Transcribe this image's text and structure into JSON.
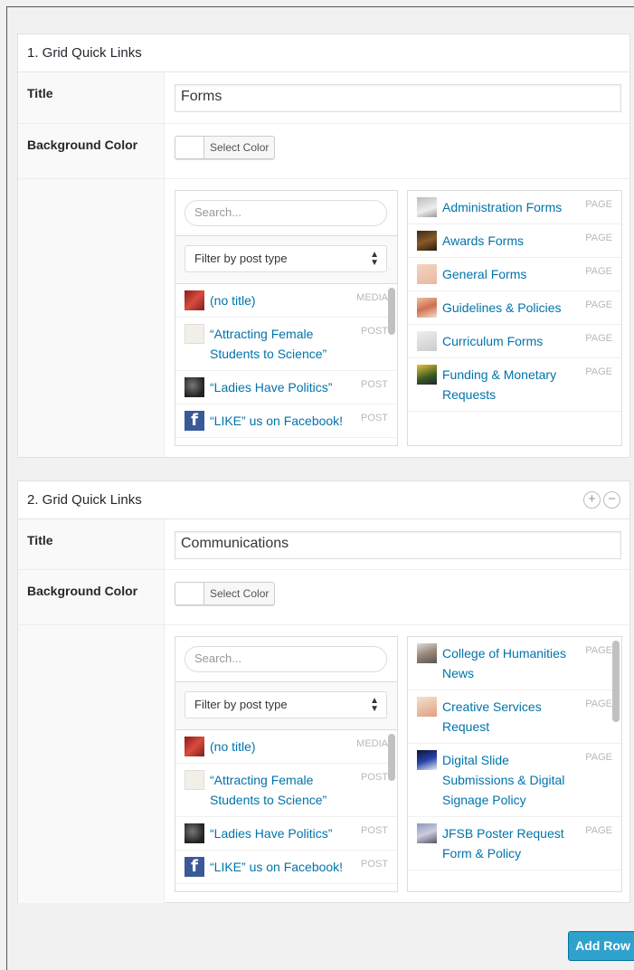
{
  "groups": [
    {
      "header": "1. Grid Quick Links",
      "title_label": "Title",
      "title_value": "Forms",
      "bg_label": "Background Color",
      "select_color": "Select Color",
      "search_placeholder": "Search...",
      "filter": "Filter by post type",
      "left_items": [
        {
          "title": "(no title)",
          "type": "MEDIA",
          "icon": "media-thumbnail"
        },
        {
          "title": "“Attracting Female Students to Science”",
          "type": "POST",
          "icon": "post-thumbnail"
        },
        {
          "title": "“Ladies Have Politics”",
          "type": "POST",
          "icon": "post-thumbnail"
        },
        {
          "title": "“LIKE” us on Facebook!",
          "type": "POST",
          "icon": "facebook-icon"
        }
      ],
      "right_items": [
        {
          "title": "Administration Forms",
          "type": "PAGE"
        },
        {
          "title": "Awards Forms",
          "type": "PAGE"
        },
        {
          "title": "General Forms",
          "type": "PAGE"
        },
        {
          "title": "Guidelines & Policies",
          "type": "PAGE"
        },
        {
          "title": "Curriculum Forms",
          "type": "PAGE"
        },
        {
          "title": "Funding & Monetary Requests",
          "type": "PAGE"
        }
      ]
    },
    {
      "header": "2. Grid Quick Links",
      "title_label": "Title",
      "title_value": "Communications",
      "bg_label": "Background Color",
      "select_color": "Select Color",
      "search_placeholder": "Search...",
      "filter": "Filter by post type",
      "left_items": [
        {
          "title": "(no title)",
          "type": "MEDIA",
          "icon": "media-thumbnail"
        },
        {
          "title": "“Attracting Female Students to Science”",
          "type": "POST",
          "icon": "post-thumbnail"
        },
        {
          "title": "“Ladies Have Politics”",
          "type": "POST",
          "icon": "post-thumbnail"
        },
        {
          "title": "“LIKE” us on Facebook!",
          "type": "POST",
          "icon": "facebook-icon"
        }
      ],
      "right_items": [
        {
          "title": "College of Humanities News",
          "type": "PAGE"
        },
        {
          "title": "Creative Services Request",
          "type": "PAGE"
        },
        {
          "title": "Digital Slide Submissions & Digital Signage Policy",
          "type": "PAGE"
        },
        {
          "title": "JFSB Poster Request Form & Policy",
          "type": "PAGE"
        }
      ]
    }
  ],
  "add_row": "Add Row",
  "icons": {
    "add": "plus-circle-icon",
    "remove": "minus-circle-icon",
    "select_arrows": "up-down-arrows-icon"
  }
}
